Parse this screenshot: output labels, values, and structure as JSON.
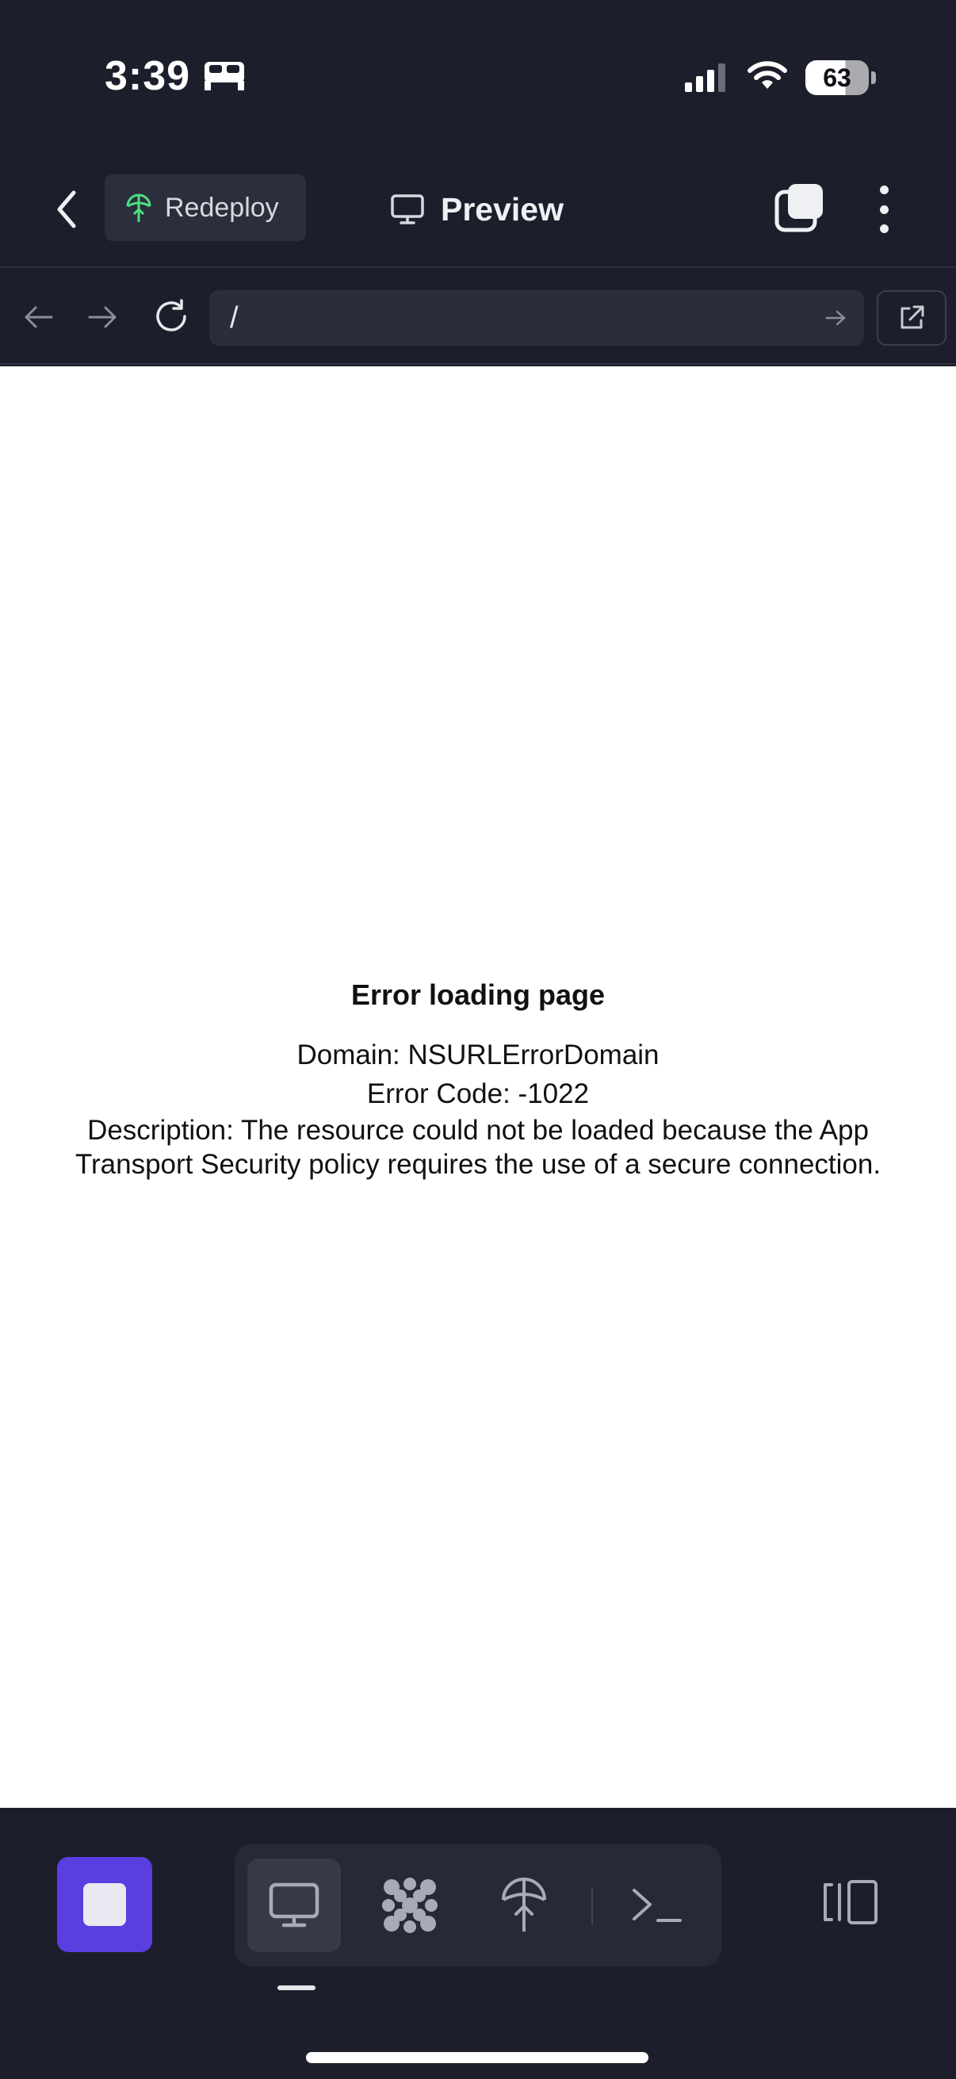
{
  "status_bar": {
    "time": "3:39",
    "battery_level": "63",
    "battery_fraction": 0.63
  },
  "top_bar": {
    "redeploy_label": "Redeploy",
    "preview_label": "Preview"
  },
  "nav": {
    "url": "/"
  },
  "page": {
    "error_title": "Error loading page",
    "domain_line": "Domain: NSURLErrorDomain",
    "code_line": "Error Code: -1022",
    "description": "Description: The resource could not be loaded because the App Transport Security policy requires the use of a secure connection."
  },
  "colors": {
    "background": "#1c1f2b",
    "accent_stop": "#5a3ee0",
    "redeploy_icon": "#4ade80"
  },
  "icons": [
    "bed-icon",
    "signal-icon",
    "wifi-icon",
    "battery-icon",
    "chevron-left-icon",
    "redeploy-icon",
    "monitor-icon",
    "tabs-icon",
    "more-icon",
    "arrow-left-icon",
    "arrow-right-icon",
    "reload-icon",
    "arrow-go-icon",
    "external-link-icon",
    "stop-icon",
    "monitor-icon",
    "apps-icon",
    "deploy-icon",
    "terminal-icon",
    "layout-icon"
  ]
}
